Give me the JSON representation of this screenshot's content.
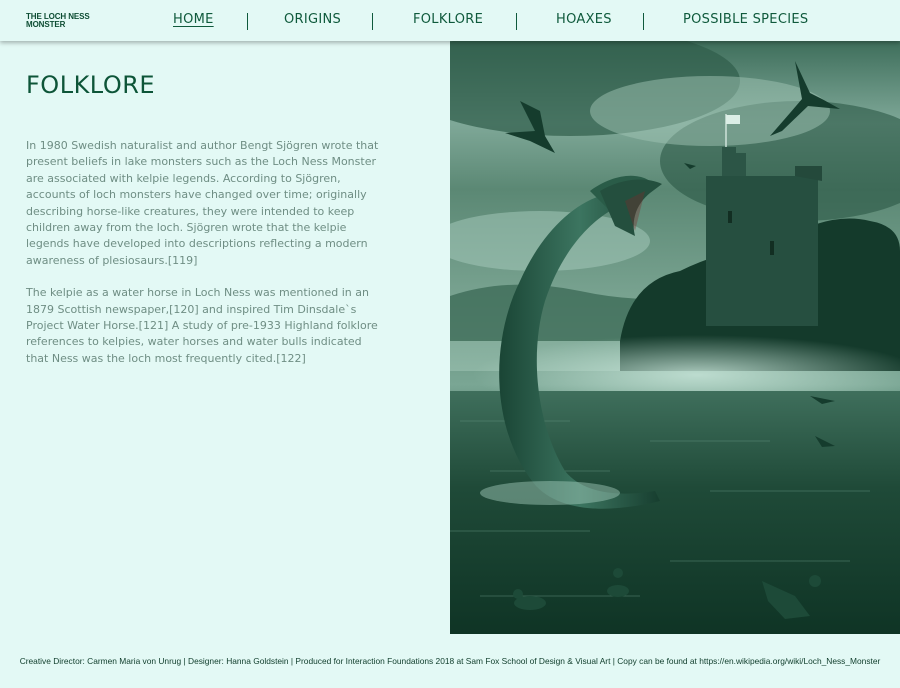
{
  "header": {
    "logo_line1": "THE LOCH NESS",
    "logo_line2": "MONSTER",
    "nav": [
      "HOME",
      "ORIGINS",
      "FOLKLORE",
      "HOAXES",
      "POSSIBLE SPECIES"
    ],
    "active_nav": "HOME"
  },
  "main": {
    "title": "FOLKLORE",
    "paragraphs": [
      "In 1980 Swedish naturalist and author Bengt Sjögren wrote that present beliefs in lake monsters such as the Loch Ness Monster are associated with kelpie legends. According to Sjögren, accounts of loch monsters have changed over time; originally describing horse-like creatures, they were intended to keep children away from the loch. Sjögren wrote that the kelpie legends have developed into descriptions reflecting a modern awareness of plesiosaurs.[119]",
      "The kelpie as a water horse in Loch Ness was mentioned in an 1879 Scottish newspaper,[120] and inspired Tim Dinsdale`s Project Water Horse.[121] A study of pre-1933 Highland folklore references to kelpies, water horses and water bulls indicated that Ness was the loch most frequently cited.[122]"
    ]
  },
  "hero_image": {
    "subject": "sea serpent rising from loch in front of castle ruin with birds and ducks",
    "tint": "#3d7a62"
  },
  "footer": {
    "credits": "Creative Director: Carmen Maria von Unrug | Designer: Hanna Goldstein | Produced for Interaction Foundations 2018 at Sam Fox School of Design & Visual Art | Copy can be found at https://en.wikipedia.org/wiki/Loch_Ness_Monster"
  },
  "colors": {
    "background": "#e3f9f5",
    "primary_text": "#0f5a3c",
    "body_text": "#6f8e84"
  }
}
